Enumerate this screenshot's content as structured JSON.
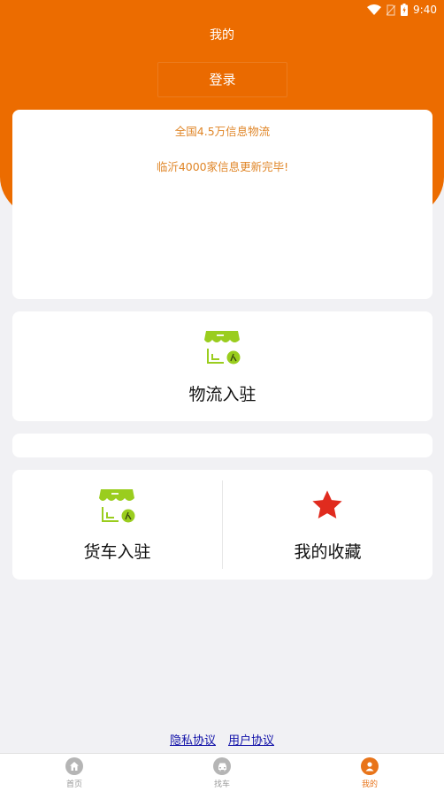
{
  "status_bar": {
    "time": "9:40"
  },
  "header": {
    "title": "我的",
    "login_label": "登录"
  },
  "notice": {
    "line1": "全国4.5万信息物流",
    "line2": "临沂4000家信息更新完毕!"
  },
  "features": {
    "logistics_join": {
      "label": "物流入驻",
      "icon": "shop-join-icon"
    },
    "truck_join": {
      "label": "货车入驻",
      "icon": "shop-join-icon"
    },
    "favorites": {
      "label": "我的收藏",
      "icon": "star-icon"
    }
  },
  "footer": {
    "privacy": "隐私协议",
    "user_agreement": "用户协议"
  },
  "tabbar": {
    "tabs": [
      {
        "label": "首页",
        "icon": "home-icon"
      },
      {
        "label": "找车",
        "icon": "car-icon"
      },
      {
        "label": "我的",
        "icon": "user-icon"
      }
    ]
  },
  "colors": {
    "brand": "#ec6c00",
    "notice_text": "#e08628",
    "icon_green": "#9acd1e",
    "star_red": "#e02b1e",
    "link": "#1010a8"
  }
}
